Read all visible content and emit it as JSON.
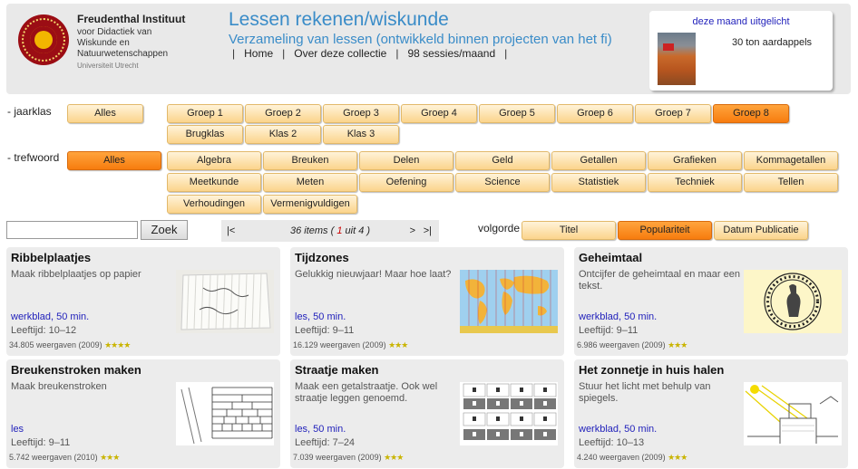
{
  "header": {
    "institute_name": "Freudenthal Instituut",
    "institute_sub": "voor Didactiek van Wiskunde en Natuurwetenschappen",
    "university": "Universiteit Utrecht",
    "title": "Lessen rekenen/wiskunde",
    "subtitle": "Verzameling van lessen (ontwikkeld binnen projecten van het fi)",
    "nav": [
      "Home",
      "Over deze collectie",
      "98 sessies/maand"
    ],
    "featured_title": "deze maand uitgelicht",
    "featured_text": "30 ton aardappels"
  },
  "filters": {
    "grade_label": "- jaarklas",
    "grade_all": "Alles",
    "grades": [
      "Groep 1",
      "Groep 2",
      "Groep 3",
      "Groep 4",
      "Groep 5",
      "Groep 6",
      "Groep 7",
      "Groep 8",
      "Brugklas",
      "Klas 2",
      "Klas 3"
    ],
    "keyword_label": "- trefwoord",
    "keyword_all": "Alles",
    "keywords": [
      "Algebra",
      "Breuken",
      "Delen",
      "Geld",
      "Getallen",
      "Grafieken",
      "Kommagetallen",
      "Meetkunde",
      "Meten",
      "Oefening",
      "Science",
      "Statistiek",
      "Techniek",
      "Tellen",
      "Verhoudingen",
      "Vermenigvuldigen"
    ]
  },
  "search": {
    "button": "Zoek",
    "value": ""
  },
  "pager": {
    "first": "|<",
    "items": "36 items (",
    "current": "1",
    "of": "uit 4 )",
    "next": ">",
    "last": ">|"
  },
  "sort": {
    "label": "volgorde",
    "options": [
      "Titel",
      "Populariteit",
      "Datum Publicatie"
    ]
  },
  "cards": [
    {
      "title": "Ribbelplaatjes",
      "desc": "Maak ribbelplaatjes op papier",
      "type": "werkblad, 50 min.",
      "age": "Leeftijd: 10–12",
      "views": "34.805 weergaven (2009)",
      "stars": "★★★★"
    },
    {
      "title": "Tijdzones",
      "desc": "Gelukkig nieuwjaar! Maar hoe laat?",
      "type": "les, 50 min.",
      "age": "Leeftijd: 9–11",
      "views": "16.129 weergaven (2009)",
      "stars": "★★★"
    },
    {
      "title": "Geheimtaal",
      "desc": "Ontcijfer de geheimtaal en maar een tekst.",
      "type": "werkblad, 50 min.",
      "age": "Leeftijd: 9–11",
      "views": "6.986 weergaven (2009)",
      "stars": "★★★"
    },
    {
      "title": "Breukenstroken maken",
      "desc": "Maak breukenstroken",
      "type": "les",
      "age": "Leeftijd: 9–11",
      "views": "5.742 weergaven (2010)",
      "stars": "★★★"
    },
    {
      "title": "Straatje maken",
      "desc": "Maak een getalstraatje. Ook wel straatje leggen genoemd.",
      "type": "les, 50 min.",
      "age": "Leeftijd: 7–24",
      "views": "7.039 weergaven (2009)",
      "stars": "★★★"
    },
    {
      "title": "Het zonnetje in huis halen",
      "desc": "Stuur het licht met behulp van spiegels.",
      "type": "werkblad, 50 min.",
      "age": "Leeftijd: 10–13",
      "views": "4.240 weergaven (2009)",
      "stars": "★★★"
    }
  ]
}
